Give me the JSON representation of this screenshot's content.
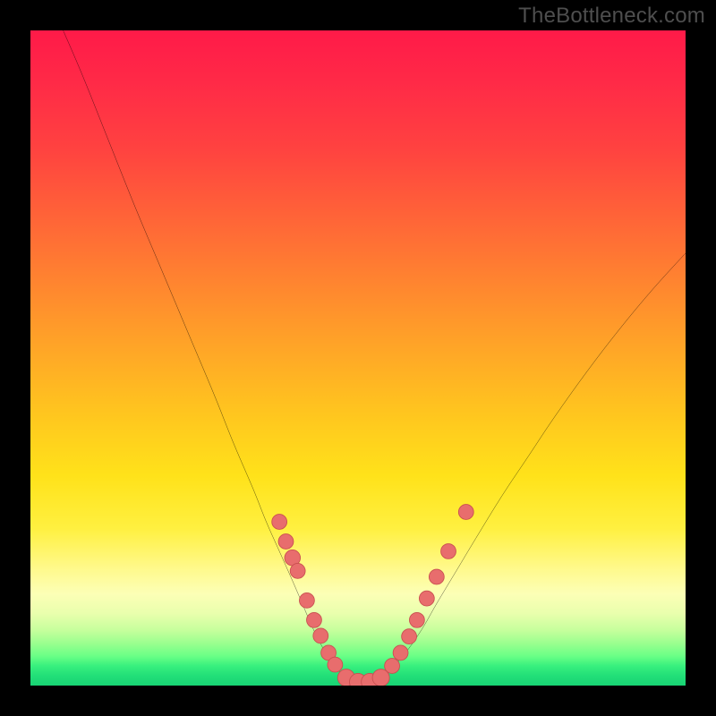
{
  "attribution": "TheBottleneck.com",
  "colors": {
    "frame": "#000000",
    "curve": "#000000",
    "marker_fill": "#e86d6d",
    "marker_stroke": "#c94f50",
    "gradient_top": "#ff1a48",
    "gradient_bottom": "#18d374"
  },
  "chart_data": {
    "type": "line",
    "title": "",
    "xlabel": "",
    "ylabel": "",
    "xlim": [
      0,
      100
    ],
    "ylim": [
      0,
      100
    ],
    "grid": false,
    "legend": false,
    "series": [
      {
        "name": "bottleneck-curve",
        "x": [
          5,
          8,
          12,
          16,
          20,
          24,
          28,
          31,
          34,
          36,
          38,
          40,
          41.5,
          43,
          44.5,
          46,
          48,
          50,
          52,
          54,
          56,
          58,
          60,
          62,
          65,
          68,
          72,
          76,
          80,
          85,
          90,
          95,
          100
        ],
        "y": [
          100,
          93,
          83,
          73,
          63.5,
          54,
          44.5,
          37,
          30,
          25,
          20.5,
          16,
          12.5,
          9,
          6,
          3.5,
          1.5,
          0.6,
          0.6,
          1.5,
          3.5,
          6,
          9,
          12.5,
          17.5,
          22.5,
          29,
          35,
          41,
          48,
          54.5,
          60.5,
          66
        ]
      }
    ],
    "markers": [
      {
        "x": 38.0,
        "y": 25.0,
        "r": 1.15
      },
      {
        "x": 39.0,
        "y": 22.0,
        "r": 1.15
      },
      {
        "x": 40.0,
        "y": 19.5,
        "r": 1.2
      },
      {
        "x": 40.8,
        "y": 17.5,
        "r": 1.15
      },
      {
        "x": 42.2,
        "y": 13.0,
        "r": 1.15
      },
      {
        "x": 43.3,
        "y": 10.0,
        "r": 1.15
      },
      {
        "x": 44.3,
        "y": 7.6,
        "r": 1.15
      },
      {
        "x": 45.5,
        "y": 5.0,
        "r": 1.15
      },
      {
        "x": 46.5,
        "y": 3.2,
        "r": 1.15
      },
      {
        "x": 48.2,
        "y": 1.2,
        "r": 1.3
      },
      {
        "x": 50.0,
        "y": 0.55,
        "r": 1.3
      },
      {
        "x": 51.8,
        "y": 0.55,
        "r": 1.3
      },
      {
        "x": 53.5,
        "y": 1.2,
        "r": 1.3
      },
      {
        "x": 55.2,
        "y": 3.0,
        "r": 1.15
      },
      {
        "x": 56.5,
        "y": 5.0,
        "r": 1.15
      },
      {
        "x": 57.8,
        "y": 7.5,
        "r": 1.15
      },
      {
        "x": 59.0,
        "y": 10.0,
        "r": 1.15
      },
      {
        "x": 60.5,
        "y": 13.3,
        "r": 1.15
      },
      {
        "x": 62.0,
        "y": 16.6,
        "r": 1.15
      },
      {
        "x": 63.8,
        "y": 20.5,
        "r": 1.15
      },
      {
        "x": 66.5,
        "y": 26.5,
        "r": 1.15
      }
    ],
    "annotations": []
  }
}
